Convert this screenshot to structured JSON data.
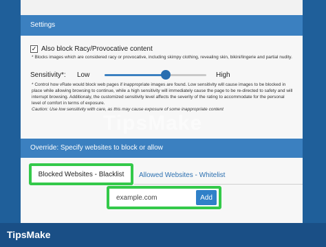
{
  "settings": {
    "header": "Settings",
    "racy_checkbox": {
      "checked": true,
      "mark": "✓",
      "label": "Also block Racy/Provocative content"
    },
    "racy_note": "* Blocks images which are considered racy or provocative, including skimpy clothing, revealing skin, bikini/lingerie and partial nudity.",
    "sensitivity": {
      "label": "Sensitivity*:",
      "low": "Low",
      "high": "High",
      "level": 0.6,
      "note": "* Control how vRate would block web pages if inappropriate images are found. Low sensitivity will cause images to be blocked in place while allowing browsing to continue, while a high sensitivity will immediately cause the page to be re-directed to safety and will interrupt browsing. Additionaly, the customized sensitivity level affects the severity of the rating to accommodate for the personal level of comfort in terms of exposure.",
      "caution": "Caution: Use low sensitivity with care, as this may cause exposure of some inappropriate content"
    }
  },
  "override": {
    "header": "Override: Specify websites to block or allow",
    "tabs": [
      {
        "label": "Blocked Websites - Blacklist",
        "active": true
      },
      {
        "label": "Allowed Websites - Whitelist",
        "active": false
      }
    ],
    "input_value": "example.com",
    "add_label": "Add"
  },
  "footer": {
    "brand": "TipsMake"
  },
  "watermark": "TipsMake",
  "colors": {
    "accent": "#3b80c0",
    "highlight": "#34c94a",
    "footer": "#1a4f86"
  }
}
